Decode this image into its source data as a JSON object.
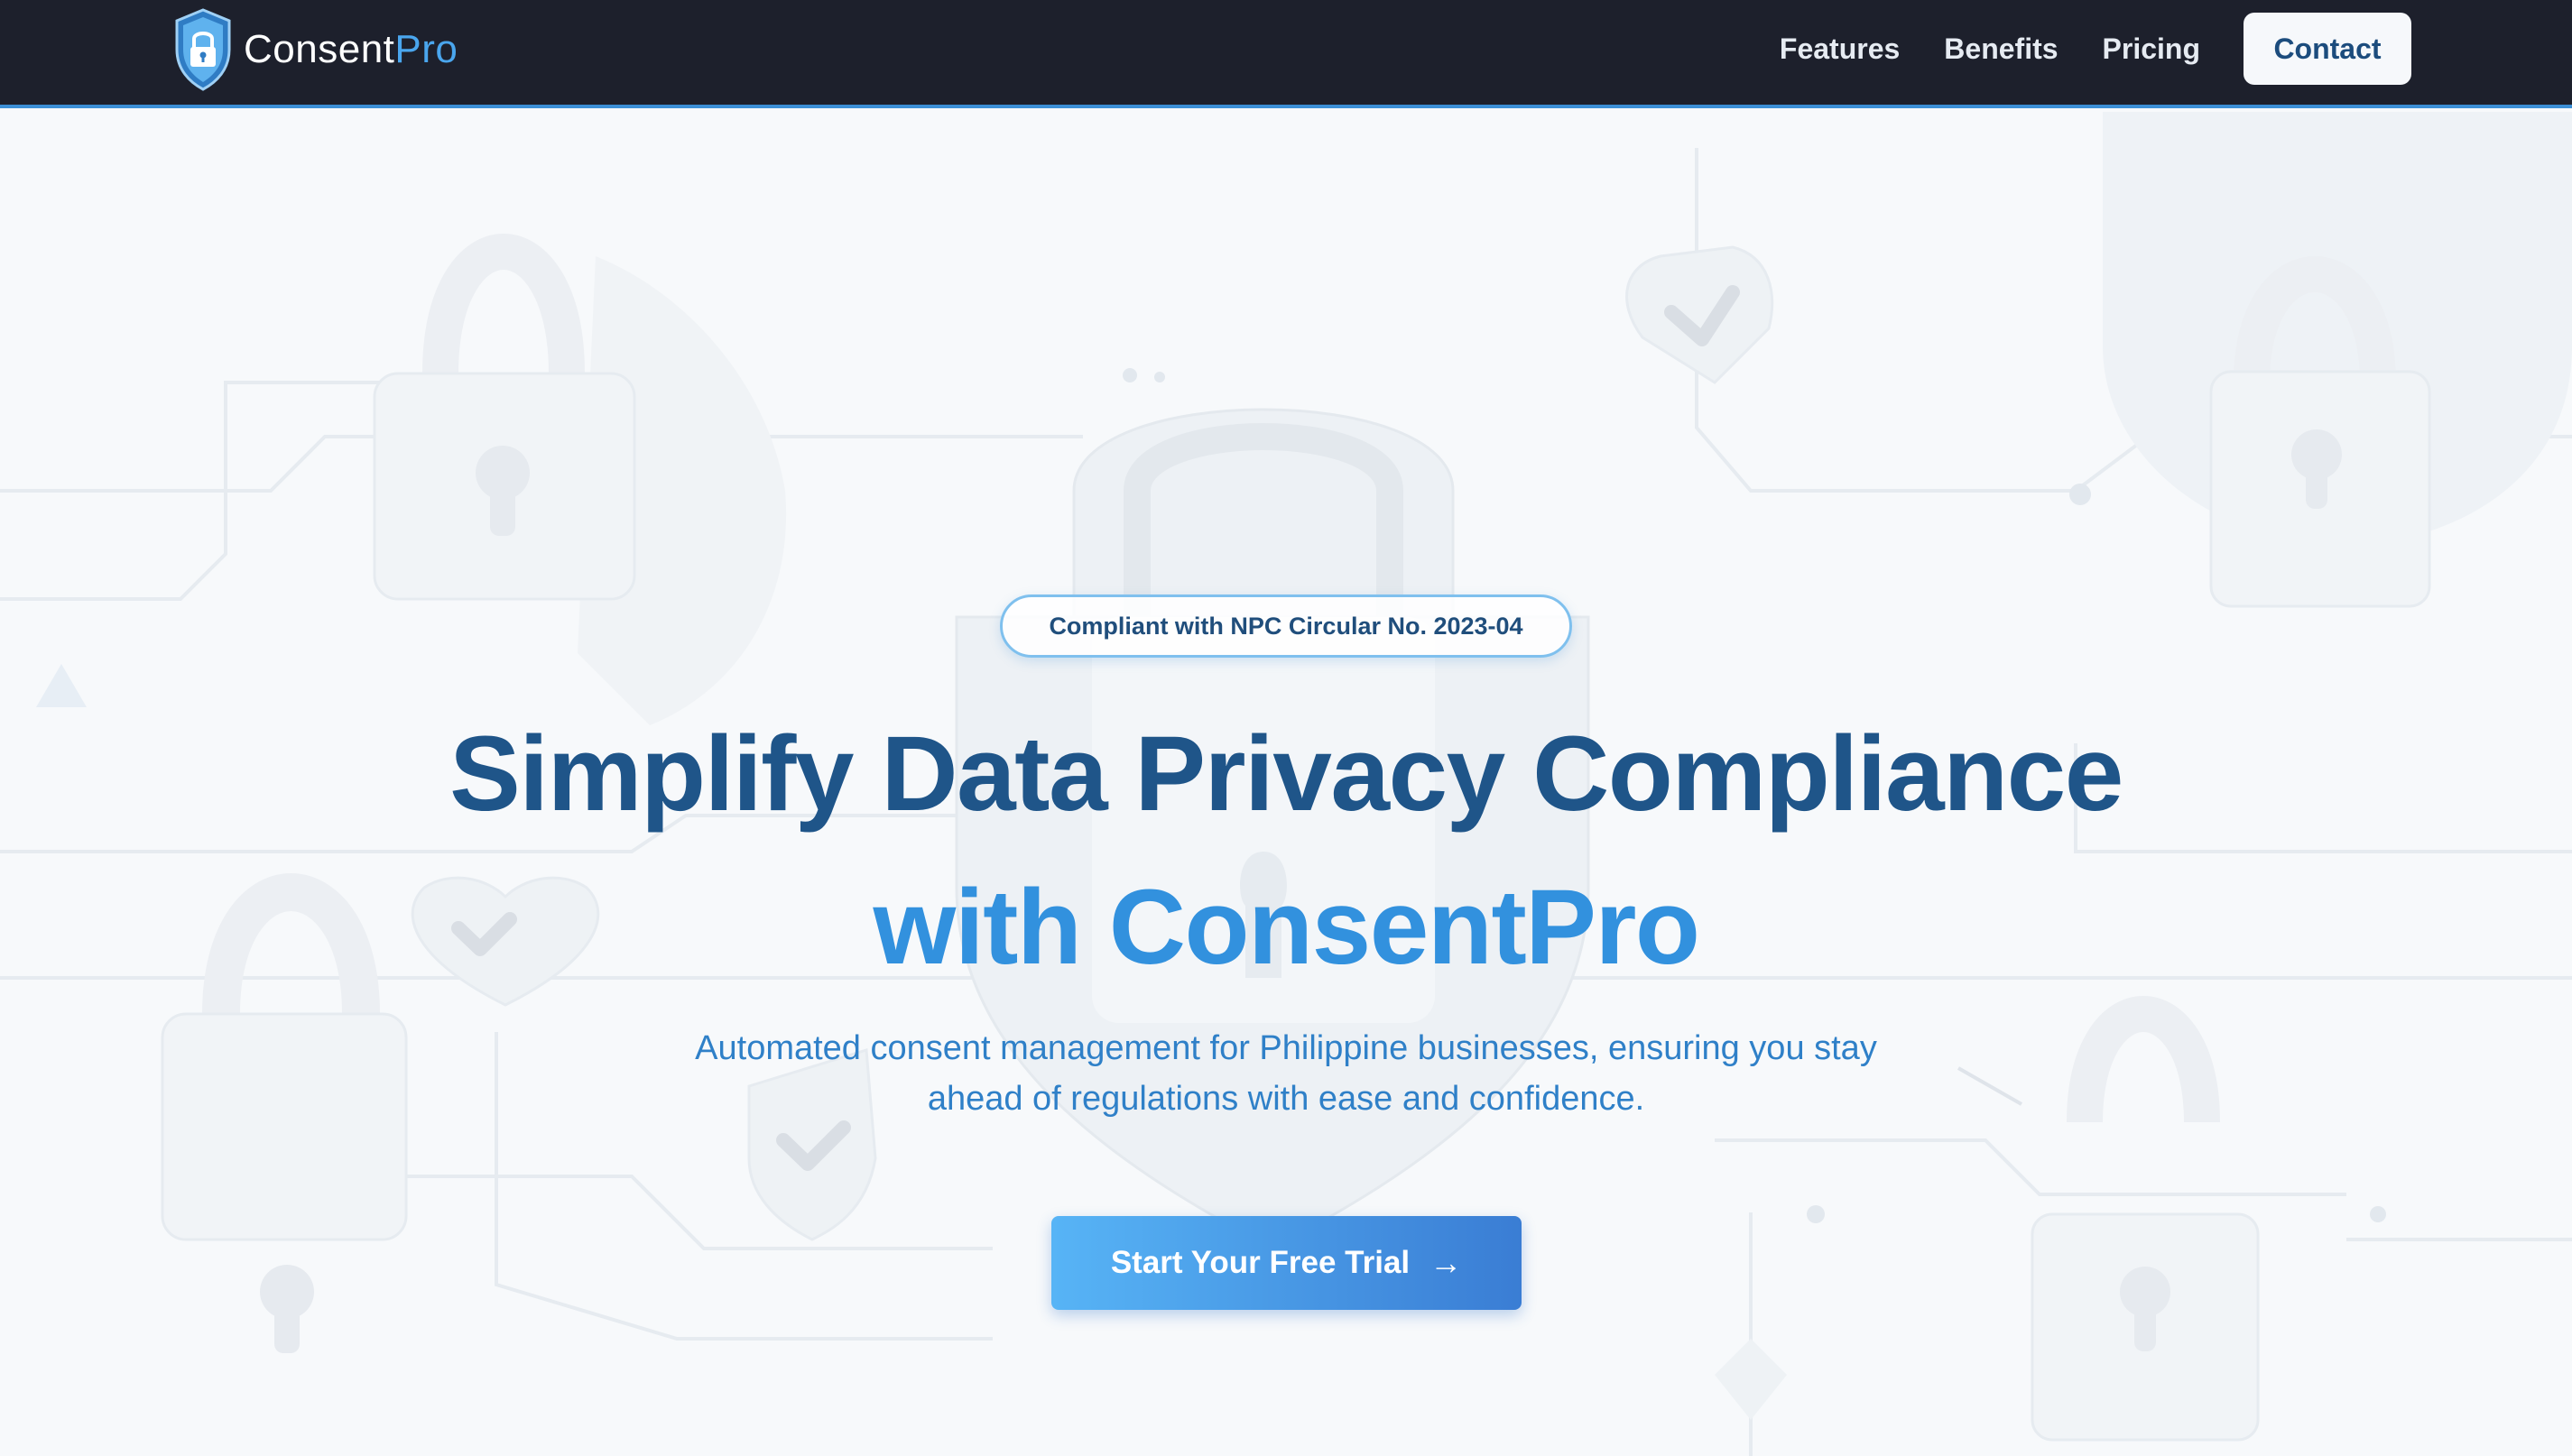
{
  "brand": {
    "name_part1": "Consent",
    "name_part2": "Pro",
    "icon": "shield-lock-icon",
    "accent_color": "#4aa6ee"
  },
  "nav": {
    "links": [
      "Features",
      "Benefits",
      "Pricing"
    ],
    "contact_label": "Contact",
    "background": "#1d202c"
  },
  "hero": {
    "badge": "Compliant with NPC Circular No. 2023-04",
    "title_line1": "Simplify Data Privacy Compliance",
    "title_line2": "with ConsentPro",
    "subtitle": "Automated consent management for Philippine businesses, ensuring you stay ahead of regulations with ease and confidence.",
    "cta_label": "Start Your Free Trial",
    "cta_icon": "arrow-right-icon"
  },
  "colors": {
    "title_dark": "#1f5589",
    "title_accent": "#3291de",
    "cta_start": "#57b4f6",
    "cta_end": "#3a7dd4"
  }
}
